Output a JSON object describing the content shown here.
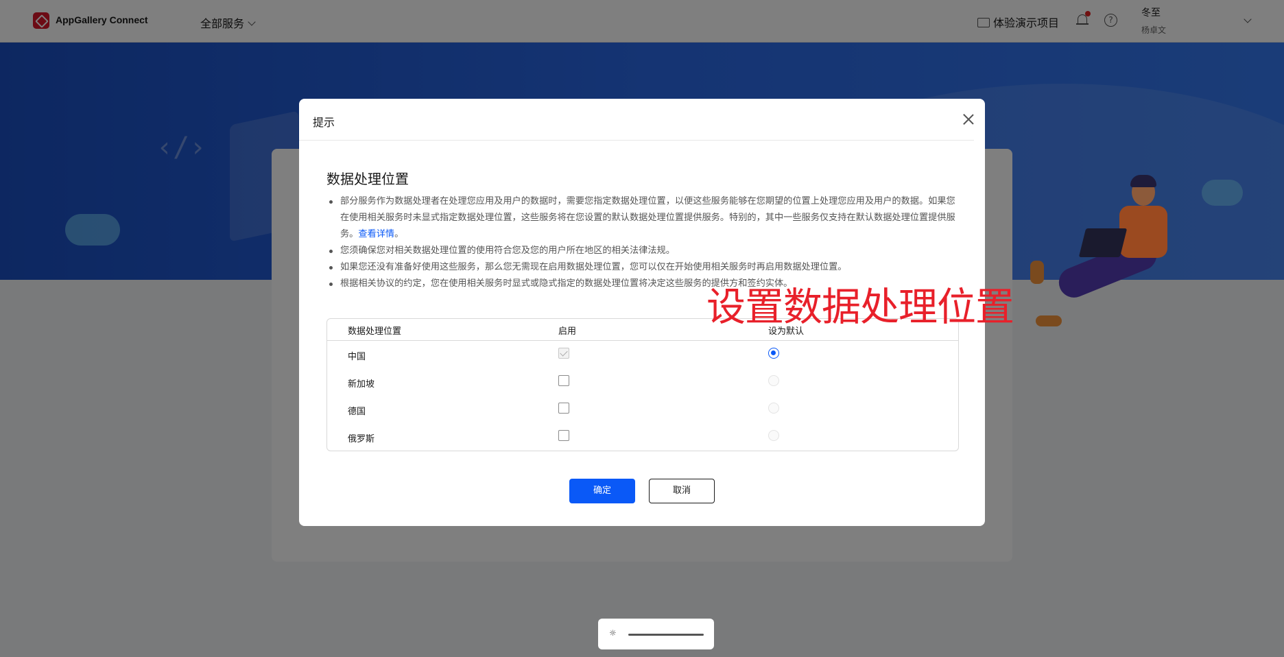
{
  "header": {
    "brand": "AppGallery Connect",
    "services_menu": "全部服务",
    "demo_project": "体验演示项目",
    "user_name": "冬至",
    "user_sub": "杨卓文"
  },
  "dialog": {
    "title": "提示",
    "section_title": "数据处理位置",
    "bullets": {
      "b1_text": "部分服务作为数据处理者在处理您应用及用户的数据时，需要您指定数据处理位置，以便这些服务能够在您期望的位置上处理您应用及用户的数据。如果您在使用相关服务时未显式指定数据处理位置，这些服务将在您设置的默认数据处理位置提供服务。特别的，其中一些服务仅支持在默认数据处理位置提供服务。",
      "b1_link": "查看详情",
      "b1_end": "。",
      "b2": "您须确保您对相关数据处理位置的使用符合您及您的用户所在地区的相关法律法规。",
      "b3": "如果您还没有准备好使用这些服务，那么您无需现在启用数据处理位置，您可以仅在开始使用相关服务时再启用数据处理位置。",
      "b4": "根据相关协议的约定，您在使用相关服务时显式或隐式指定的数据处理位置将决定这些服务的提供方和签约实体。"
    },
    "annotation": "设置数据处理位置",
    "table": {
      "columns": [
        "数据处理位置",
        "启用",
        "设为默认"
      ],
      "rows": [
        {
          "location": "中国",
          "enabled": true,
          "enabled_locked": true,
          "default": true
        },
        {
          "location": "新加坡",
          "enabled": false,
          "enabled_locked": false,
          "default": false
        },
        {
          "location": "德国",
          "enabled": false,
          "enabled_locked": false,
          "default": false
        },
        {
          "location": "俄罗斯",
          "enabled": false,
          "enabled_locked": false,
          "default": false
        }
      ]
    },
    "buttons": {
      "confirm": "确定",
      "cancel": "取消"
    }
  },
  "brightness_bar": {
    "icon": "sun-icon",
    "glyph": "☼"
  },
  "colors": {
    "brand_red": "#d9162a",
    "accent_blue": "#0a59f7",
    "annotation_red": "#e8202a",
    "banner_blue": "#2a68e6"
  }
}
